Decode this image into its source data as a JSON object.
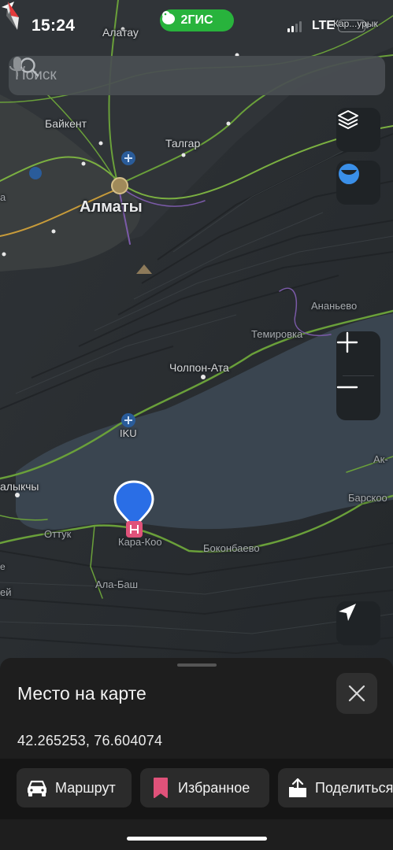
{
  "status_bar": {
    "time": "15:24",
    "app_name": "2ГИС",
    "network": "LTE",
    "battery_text": ""
  },
  "search": {
    "placeholder": "Поиск"
  },
  "map": {
    "labels": {
      "alatau": "Алатау",
      "baikent": "Байкент",
      "talgar": "Талгар",
      "almaty": "Алматы",
      "ananevo": "Ананьево",
      "temirovka": "Темировка",
      "cholpon_ata": "Чолпон-Ата",
      "iku": "IKU",
      "balykchy": "алыкчы",
      "ottuk": "Оттук",
      "kara_koo": "Кара-Коо",
      "bokonbaevo": "Боконбаево",
      "ala_bash": "Ала-Баш",
      "barskoon": "Барскоо",
      "ak_s": "Ак-",
      "karakol_fragment": "Кар...урык",
      "edge_a": "а",
      "edge_e": "е",
      "edge_ey": "ей"
    },
    "controls": {
      "layers_icon": "layers-icon",
      "zoom_in_icon": "plus-icon",
      "zoom_out_icon": "minus-icon",
      "locate_icon": "navigation-arrow-icon"
    },
    "colors": {
      "water": "#3a4550",
      "land": "#2a2e32",
      "road": "#6aa03a",
      "marker": "#2a6ee6",
      "pin": "#e0527a"
    }
  },
  "place_sheet": {
    "title": "Место на карте",
    "coordinates": "42.265253, 76.604074",
    "actions": [
      {
        "label": "Маршрут",
        "icon": "car-icon"
      },
      {
        "label": "Избранное",
        "icon": "bookmark-icon"
      },
      {
        "label": "Поделиться",
        "icon": "share-icon"
      }
    ]
  }
}
